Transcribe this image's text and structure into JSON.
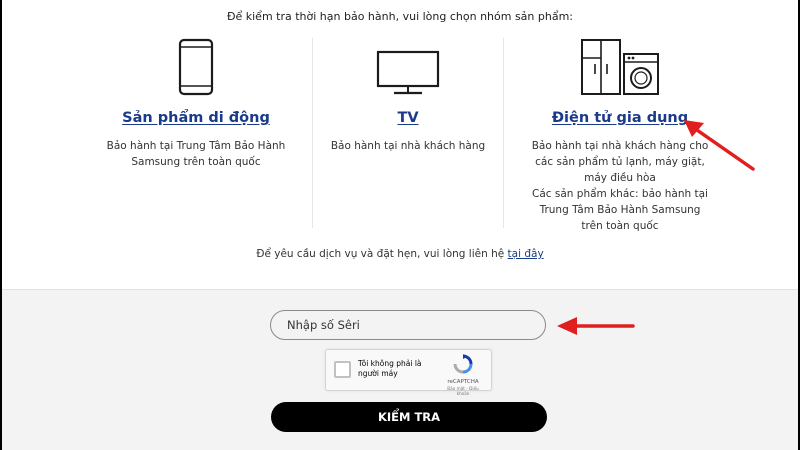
{
  "intro_text": "Để kiểm tra thời hạn bảo hành, vui lòng chọn nhóm sản phẩm:",
  "products": [
    {
      "title": "Sản phẩm di động",
      "desc": "Bảo hành tại Trung Tâm Bảo Hành\nSamsung trên toàn quốc"
    },
    {
      "title": "TV",
      "desc": "Bảo hành tại nhà khách hàng"
    },
    {
      "title": "Điện tử gia dụng",
      "desc": "Bảo hành tại nhà khách hàng cho\ncác sản phẩm tủ lạnh, máy giặt,\nmáy điều hòa\nCác sản phẩm khác: bảo hành tại\nTrung Tâm Bảo Hành Samsung\ntrên toàn quốc"
    }
  ],
  "service": {
    "text": "Để yêu cầu dịch vụ và đặt hẹn, vui lòng liên hệ",
    "link": "tại đây"
  },
  "serial": {
    "placeholder": "Nhập số Sêri",
    "value": ""
  },
  "captcha": {
    "label": "Tôi không phải là người máy",
    "brand": "reCAPTCHA",
    "terms": "Bảo mật - Điều khoản"
  },
  "submit_label": "KIỂM TRA",
  "colors": {
    "link": "#1a3a8a",
    "arrow": "#e01f1f",
    "button": "#000000",
    "form_bg": "#f3f3f3"
  },
  "icons": [
    "smartphone-icon",
    "tv-icon",
    "home-appliance-icon",
    "recaptcha-logo-icon"
  ]
}
